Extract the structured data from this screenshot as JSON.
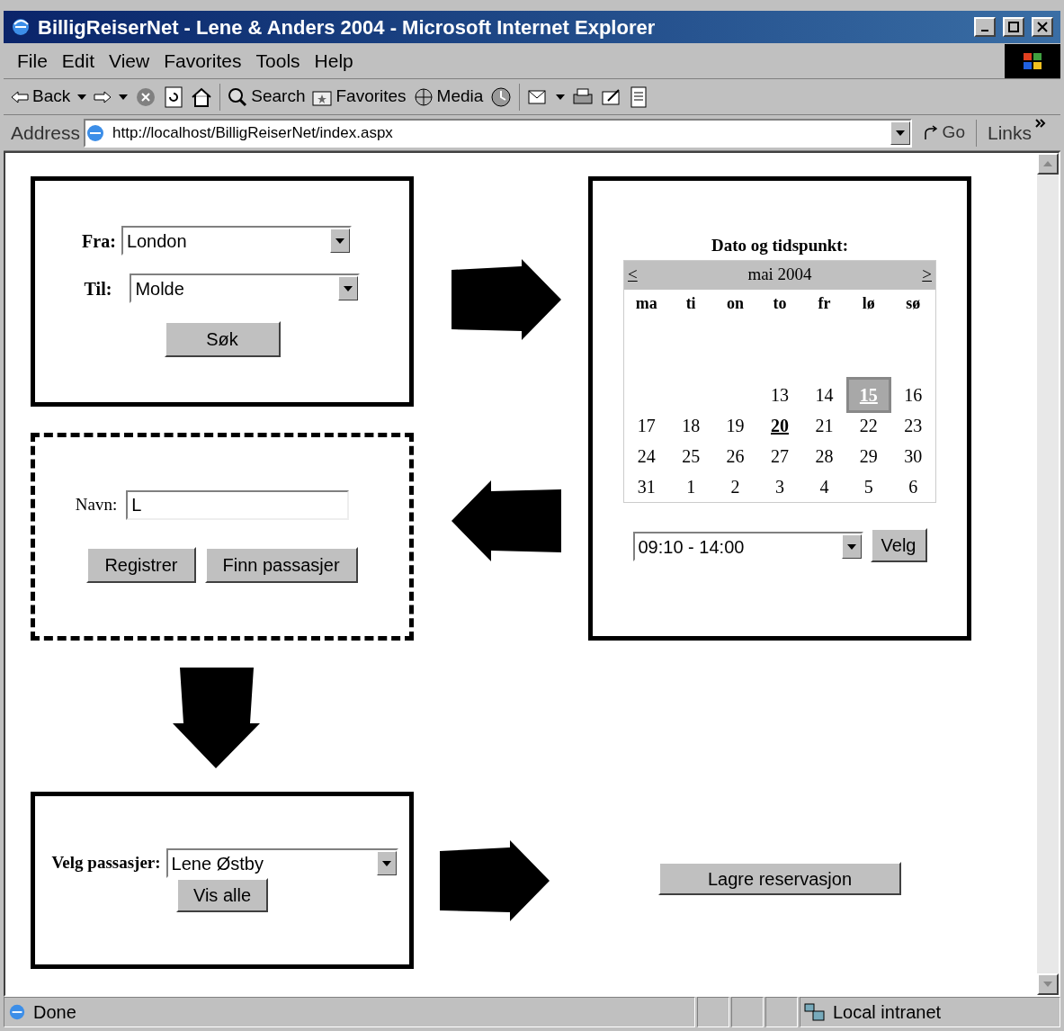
{
  "window": {
    "title": "BilligReiserNet - Lene & Anders 2004 - Microsoft Internet Explorer"
  },
  "menu": [
    "File",
    "Edit",
    "View",
    "Favorites",
    "Tools",
    "Help"
  ],
  "toolbar": {
    "back": "Back",
    "search": "Search",
    "favorites": "Favorites",
    "media": "Media"
  },
  "address_bar": {
    "label": "Address",
    "url": "http://localhost/BilligReiserNet/index.aspx",
    "go": "Go",
    "links": "Links"
  },
  "route_form": {
    "from_label": "Fra:",
    "from_value": "London",
    "to_label": "Til:",
    "to_value": "Molde",
    "button": "Søk"
  },
  "calendar": {
    "title": "Dato og tidspunkt:",
    "prev": "<",
    "next": ">",
    "month": "mai 2004",
    "weekdays": [
      "ma",
      "ti",
      "on",
      "to",
      "fr",
      "lø",
      "sø"
    ],
    "weeks": [
      [
        {
          "kind": "empty"
        },
        {
          "kind": "empty"
        },
        {
          "kind": "empty"
        },
        {
          "kind": "empty"
        },
        {
          "kind": "empty"
        },
        {
          "kind": "empty"
        },
        {
          "kind": "empty"
        }
      ],
      [
        {
          "kind": "empty"
        },
        {
          "kind": "empty"
        },
        {
          "kind": "empty"
        },
        {
          "kind": "empty"
        },
        {
          "kind": "empty"
        },
        {
          "kind": "empty"
        },
        {
          "kind": "empty"
        }
      ],
      [
        {
          "kind": "empty"
        },
        {
          "kind": "empty"
        },
        {
          "kind": "empty"
        },
        {
          "kind": "day",
          "day": "13",
          "selected": false,
          "today": false
        },
        {
          "kind": "day",
          "day": "14",
          "selected": false,
          "today": false
        },
        {
          "kind": "day",
          "day": "15",
          "selected": true,
          "today": false
        },
        {
          "kind": "day",
          "day": "16",
          "selected": false,
          "today": false
        }
      ],
      [
        {
          "kind": "day",
          "day": "17",
          "selected": false,
          "today": false
        },
        {
          "kind": "day",
          "day": "18",
          "selected": false,
          "today": false
        },
        {
          "kind": "day",
          "day": "19",
          "selected": false,
          "today": false
        },
        {
          "kind": "day",
          "day": "20",
          "selected": false,
          "today": true
        },
        {
          "kind": "day",
          "day": "21",
          "selected": false,
          "today": false
        },
        {
          "kind": "day",
          "day": "22",
          "selected": false,
          "today": false
        },
        {
          "kind": "day",
          "day": "23",
          "selected": false,
          "today": false
        }
      ],
      [
        {
          "kind": "day",
          "day": "24",
          "selected": false,
          "today": false
        },
        {
          "kind": "day",
          "day": "25",
          "selected": false,
          "today": false
        },
        {
          "kind": "day",
          "day": "26",
          "selected": false,
          "today": false
        },
        {
          "kind": "day",
          "day": "27",
          "selected": false,
          "today": false
        },
        {
          "kind": "day",
          "day": "28",
          "selected": false,
          "today": false
        },
        {
          "kind": "day",
          "day": "29",
          "selected": false,
          "today": false
        },
        {
          "kind": "day",
          "day": "30",
          "selected": false,
          "today": false
        }
      ],
      [
        {
          "kind": "day",
          "day": "31",
          "selected": false,
          "today": false
        },
        {
          "kind": "day",
          "day": "1",
          "selected": false,
          "today": false
        },
        {
          "kind": "day",
          "day": "2",
          "selected": false,
          "today": false
        },
        {
          "kind": "day",
          "day": "3",
          "selected": false,
          "today": false
        },
        {
          "kind": "day",
          "day": "4",
          "selected": false,
          "today": false
        },
        {
          "kind": "day",
          "day": "5",
          "selected": false,
          "today": false
        },
        {
          "kind": "day",
          "day": "6",
          "selected": false,
          "today": false
        }
      ]
    ],
    "time_value": "09:10 - 14:00",
    "button": "Velg"
  },
  "register_form": {
    "name_label": "Navn:",
    "name_value": "L",
    "buttons": [
      "Registrer",
      "Finn passasjer"
    ]
  },
  "passenger_form": {
    "label": "Velg passasjer:",
    "value": "Lene Østby",
    "button": "Vis alle"
  },
  "save_button": "Lagre reservasjon",
  "status_bar": {
    "text": "Done",
    "zone": "Local intranet"
  }
}
